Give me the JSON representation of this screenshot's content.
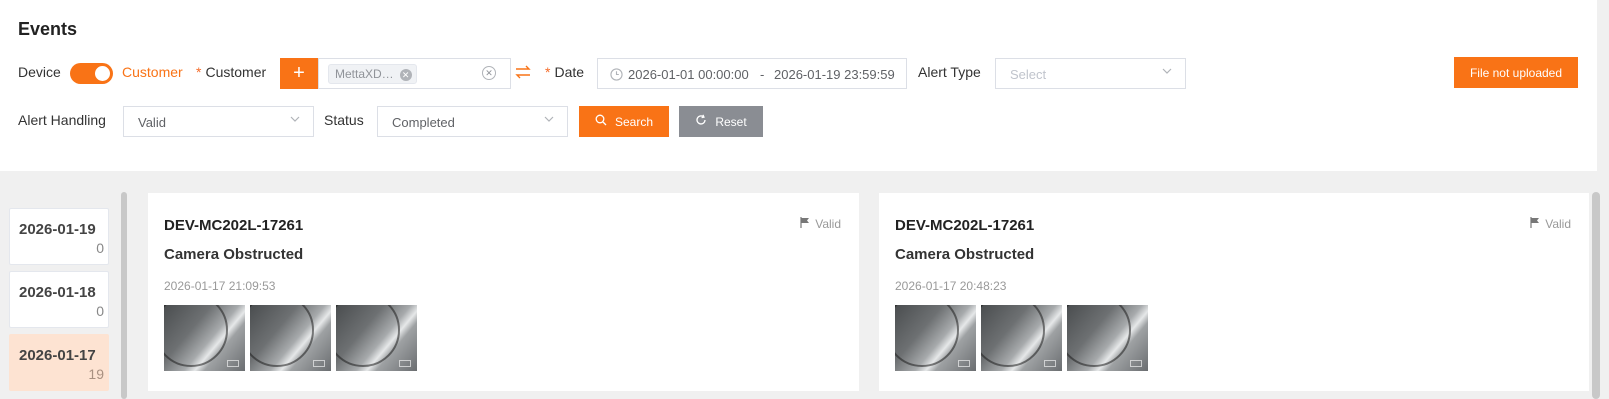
{
  "header": {
    "title": "Events"
  },
  "filters": {
    "device_label": "Device",
    "customer_toggle_label": "Customer",
    "customer_label": "Customer",
    "customer_add": "+",
    "customer_tag": "MettaXD…",
    "date_label": "Date",
    "date_start": "2026-01-01 00:00:00",
    "date_separator": "-",
    "date_end": "2026-01-19 23:59:59",
    "alert_type_label": "Alert Type",
    "alert_type_placeholder": "Select",
    "file_button": "File not uploaded",
    "alert_handling_label": "Alert Handling",
    "alert_handling_value": "Valid",
    "status_label": "Status",
    "status_value": "Completed",
    "search_button": "Search",
    "reset_button": "Reset"
  },
  "date_list": [
    {
      "date": "2026-01-19",
      "count": "0",
      "active": false
    },
    {
      "date": "2026-01-18",
      "count": "0",
      "active": false
    },
    {
      "date": "2026-01-17",
      "count": "19",
      "active": true
    }
  ],
  "events": [
    {
      "device": "DEV-MC202L-17261",
      "type": "Camera Obstructed",
      "time": "2026-01-17 21:09:53",
      "status": "Valid"
    },
    {
      "device": "DEV-MC202L-17261",
      "type": "Camera Obstructed",
      "time": "2026-01-17 20:48:23",
      "status": "Valid"
    }
  ],
  "colors": {
    "accent": "#f97316",
    "active_date_bg": "#fde3d2",
    "reset_gray": "#8a8d93"
  }
}
